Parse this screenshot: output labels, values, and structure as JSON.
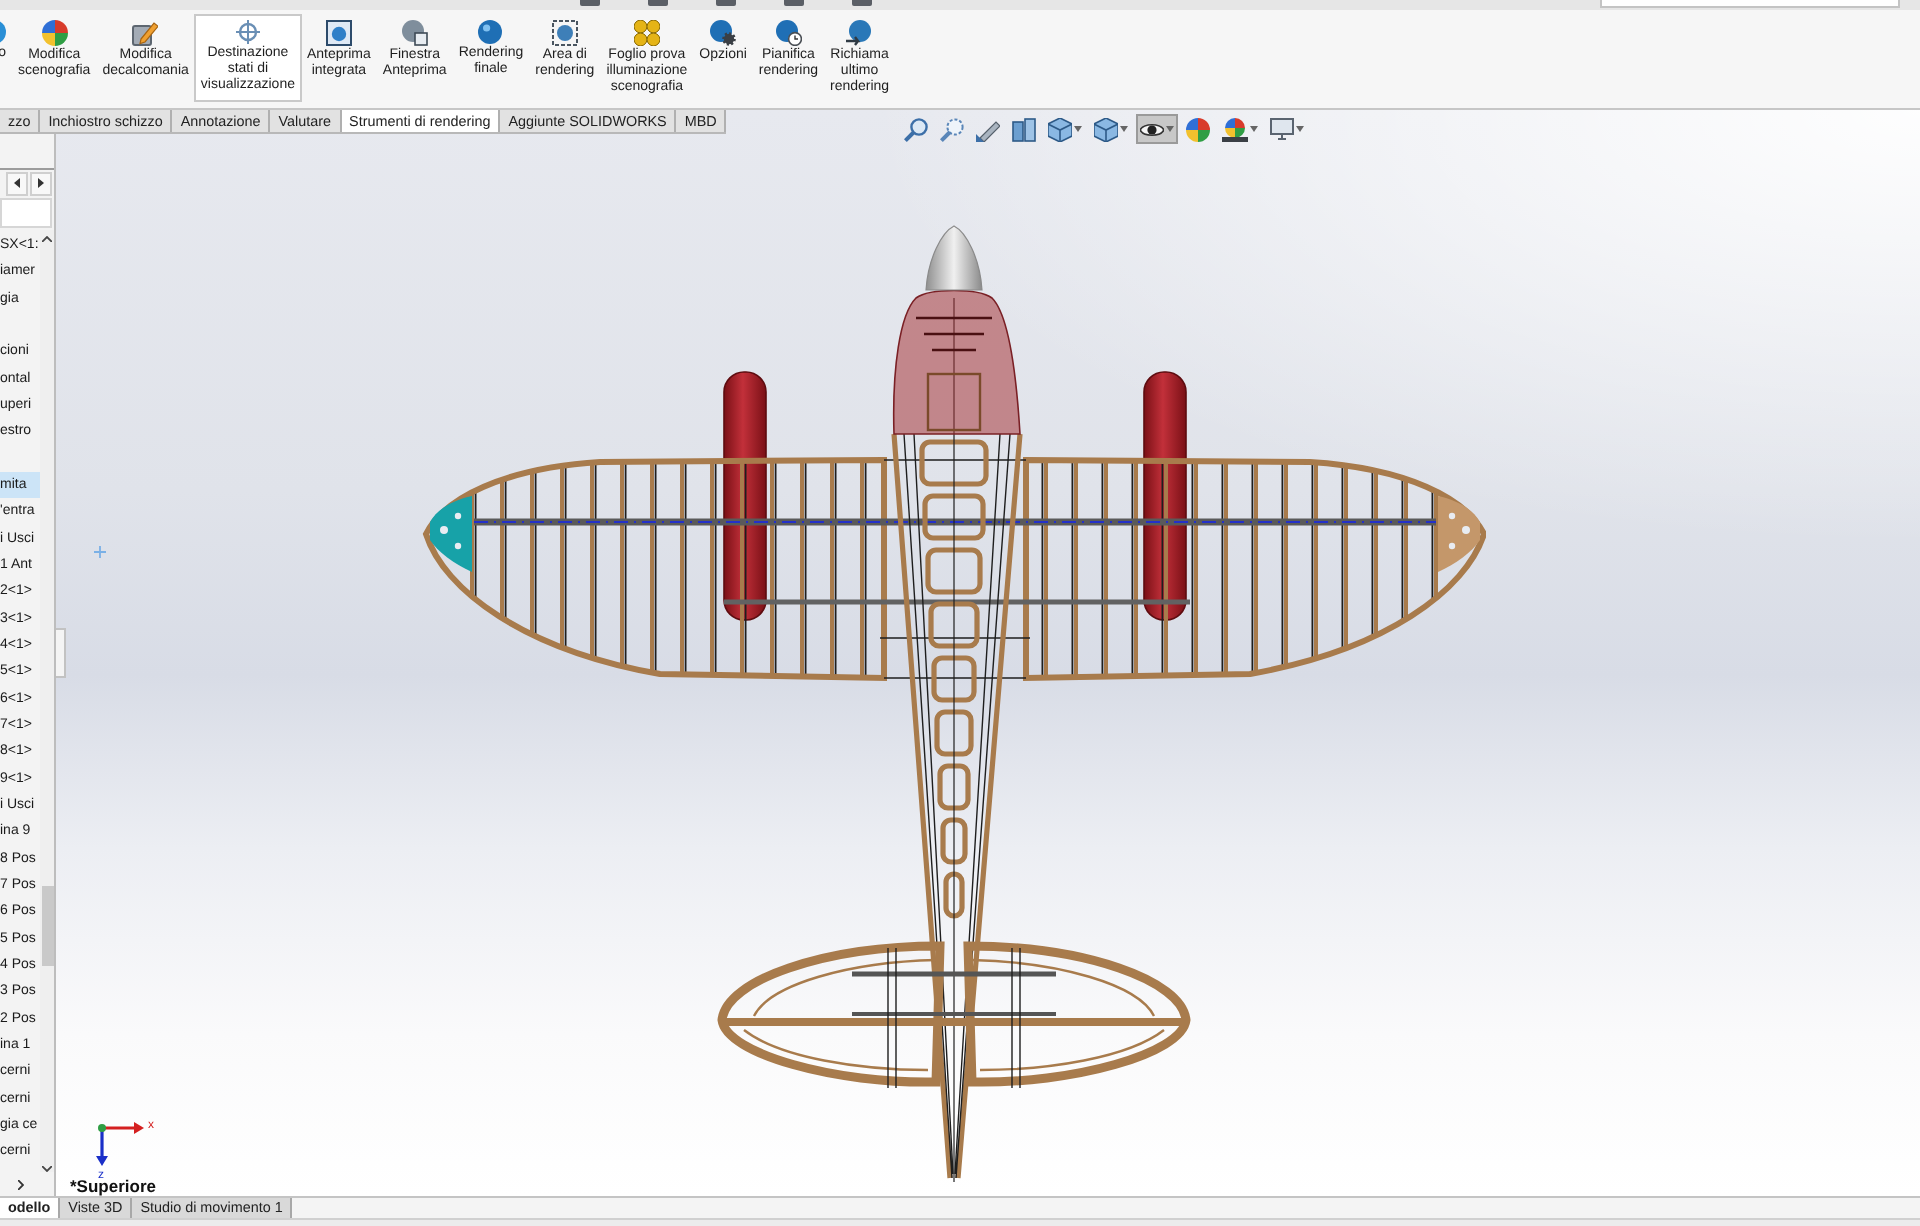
{
  "ribbon": {
    "buttons": [
      {
        "label": "o",
        "selected": false
      },
      {
        "label": "Modifica\nscenografia",
        "selected": false
      },
      {
        "label": "Modifica\ndecalcomania",
        "selected": false
      },
      {
        "label": "Destinazione\nstati di\nvisualizzazione",
        "selected": true
      },
      {
        "label": "Anteprima\nintegrata",
        "selected": false
      },
      {
        "label": "Finestra\nAnteprima",
        "selected": false
      },
      {
        "label": "Rendering\nfinale",
        "selected": false
      },
      {
        "label": "Area di\nrendering",
        "selected": false
      },
      {
        "label": "Foglio prova\nilluminazione\nscenografia",
        "selected": false
      },
      {
        "label": "Opzioni",
        "selected": false
      },
      {
        "label": "Pianifica\nrendering",
        "selected": false
      },
      {
        "label": "Richiama\nultimo\nrendering",
        "selected": false
      }
    ]
  },
  "command_tabs": [
    {
      "label": "zzo",
      "selected": false
    },
    {
      "label": "Inchiostro schizzo",
      "selected": false
    },
    {
      "label": "Annotazione",
      "selected": false
    },
    {
      "label": "Valutare",
      "selected": false
    },
    {
      "label": "Strumenti di rendering",
      "selected": true
    },
    {
      "label": "Aggiunte SOLIDWORKS",
      "selected": false
    },
    {
      "label": "MBD",
      "selected": false
    }
  ],
  "view_toolbar": {
    "items": [
      {
        "selected": false,
        "dropdown": false
      },
      {
        "selected": false,
        "dropdown": false
      },
      {
        "selected": false,
        "dropdown": false
      },
      {
        "selected": false,
        "dropdown": false
      },
      {
        "selected": false,
        "dropdown": true
      },
      {
        "selected": false,
        "dropdown": true
      },
      {
        "selected": true,
        "dropdown": true
      },
      {
        "selected": false,
        "dropdown": false
      },
      {
        "selected": false,
        "dropdown": true
      },
      {
        "selected": false,
        "dropdown": true
      }
    ]
  },
  "feature_tree": {
    "groups": [
      {
        "items": [
          {
            "label": "SX<1:",
            "selected": false
          },
          {
            "label": "iamer",
            "selected": false
          },
          {
            "label": "gia",
            "selected": false
          }
        ]
      },
      {
        "items": [
          {
            "label": "cioni",
            "selected": false
          },
          {
            "label": "ontal",
            "selected": false
          },
          {
            "label": "uperi",
            "selected": false
          },
          {
            "label": "estro",
            "selected": false
          }
        ]
      },
      {
        "items": [
          {
            "label": "mita",
            "selected": true
          },
          {
            "label": "'entra",
            "selected": false
          },
          {
            "label": "i Usci",
            "selected": false
          },
          {
            "label": "1 Ant",
            "selected": false
          },
          {
            "label": "2<1>",
            "selected": false
          },
          {
            "label": "3<1>",
            "selected": false
          },
          {
            "label": "4<1>",
            "selected": false
          },
          {
            "label": "5<1>",
            "selected": false
          },
          {
            "label": "6<1>",
            "selected": false
          },
          {
            "label": "7<1>",
            "selected": false
          },
          {
            "label": "8<1>",
            "selected": false
          },
          {
            "label": "9<1>",
            "selected": false
          },
          {
            "label": "i Usci",
            "selected": false
          },
          {
            "label": "ina 9",
            "selected": false
          },
          {
            "label": "8 Pos",
            "selected": false
          },
          {
            "label": "7 Pos",
            "selected": false
          },
          {
            "label": "6 Pos",
            "selected": false
          },
          {
            "label": "5 Pos",
            "selected": false
          },
          {
            "label": "4 Pos",
            "selected": false
          },
          {
            "label": "3 Pos",
            "selected": false
          },
          {
            "label": "2 Pos",
            "selected": false
          },
          {
            "label": "ina 1",
            "selected": false
          },
          {
            "label": "cerni",
            "selected": false
          },
          {
            "label": "cerni",
            "selected": false
          },
          {
            "label": "gia ce",
            "selected": false
          },
          {
            "label": "cerni",
            "selected": false
          }
        ]
      }
    ]
  },
  "viewport": {
    "view_name": "*Superiore",
    "triad": {
      "x_label": "x",
      "z_label": "z"
    }
  },
  "bottom_tabs": [
    {
      "label": "odello",
      "selected": true
    },
    {
      "label": "Viste 3D",
      "selected": false
    },
    {
      "label": "Studio di movimento 1",
      "selected": false
    }
  ]
}
